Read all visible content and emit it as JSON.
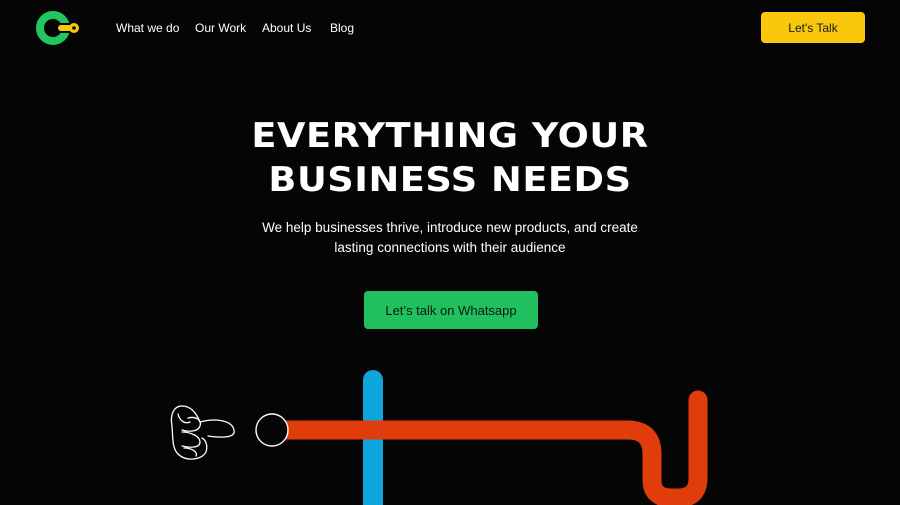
{
  "header": {
    "logo_icon": "brand-c-logo-icon",
    "nav": [
      {
        "label": "What we do"
      },
      {
        "label": "Our Work"
      },
      {
        "label": "About Us"
      },
      {
        "label": "Blog"
      }
    ],
    "cta_label": "Let's Talk"
  },
  "hero": {
    "title_line1": "EVERYTHING YOUR",
    "title_line2": "BUSINESS NEEDS",
    "subtitle": "We help businesses thrive, introduce new products, and create lasting connections with their audience",
    "whatsapp_label": "Let’s talk on Whatsapp"
  },
  "illustration": {
    "hand_icon": "pointing-hand-icon",
    "circle_icon": "ring-icon"
  },
  "colors": {
    "background": "#050505",
    "accent_yellow": "#f9c70c",
    "accent_green": "#21c05e",
    "pipe_orange": "#e03c0c",
    "pipe_blue": "#0ea5dd",
    "logo_green": "#22c55e"
  }
}
